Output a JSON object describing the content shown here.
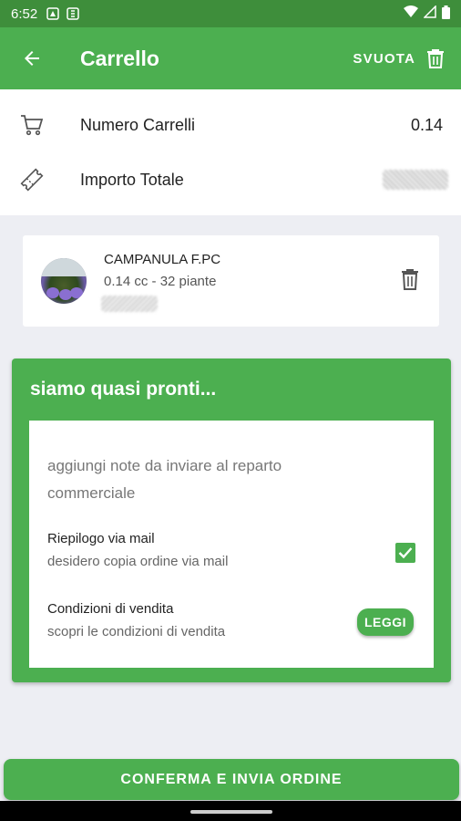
{
  "status_bar": {
    "time": "6:52"
  },
  "app_bar": {
    "title": "Carrello",
    "clear_label": "SVUOTA"
  },
  "summary": {
    "rows": [
      {
        "label": "Numero Carrelli",
        "value": "0.14",
        "icon": "cart-icon"
      },
      {
        "label": "Importo Totale",
        "value": "",
        "icon": "ticket-icon"
      }
    ]
  },
  "product": {
    "name": "CAMPANULA F.PC",
    "detail": "0.14 cc - 32 piante"
  },
  "panel": {
    "title": "siamo quasi pronti...",
    "notes_placeholder": "aggiungi note da inviare al reparto commerciale",
    "email_summary": {
      "title": "Riepilogo via mail",
      "subtitle": "desidero copia ordine via mail",
      "checked": true
    },
    "conditions": {
      "title": "Condizioni di vendita",
      "subtitle": "scopri le condizioni di vendita",
      "button_label": "LEGGI"
    }
  },
  "confirm_button_label": "CONFERMA E INVIA ORDINE",
  "colors": {
    "primary": "#4caf50",
    "status_bar": "#3e8e3b",
    "background": "#edeef3"
  }
}
